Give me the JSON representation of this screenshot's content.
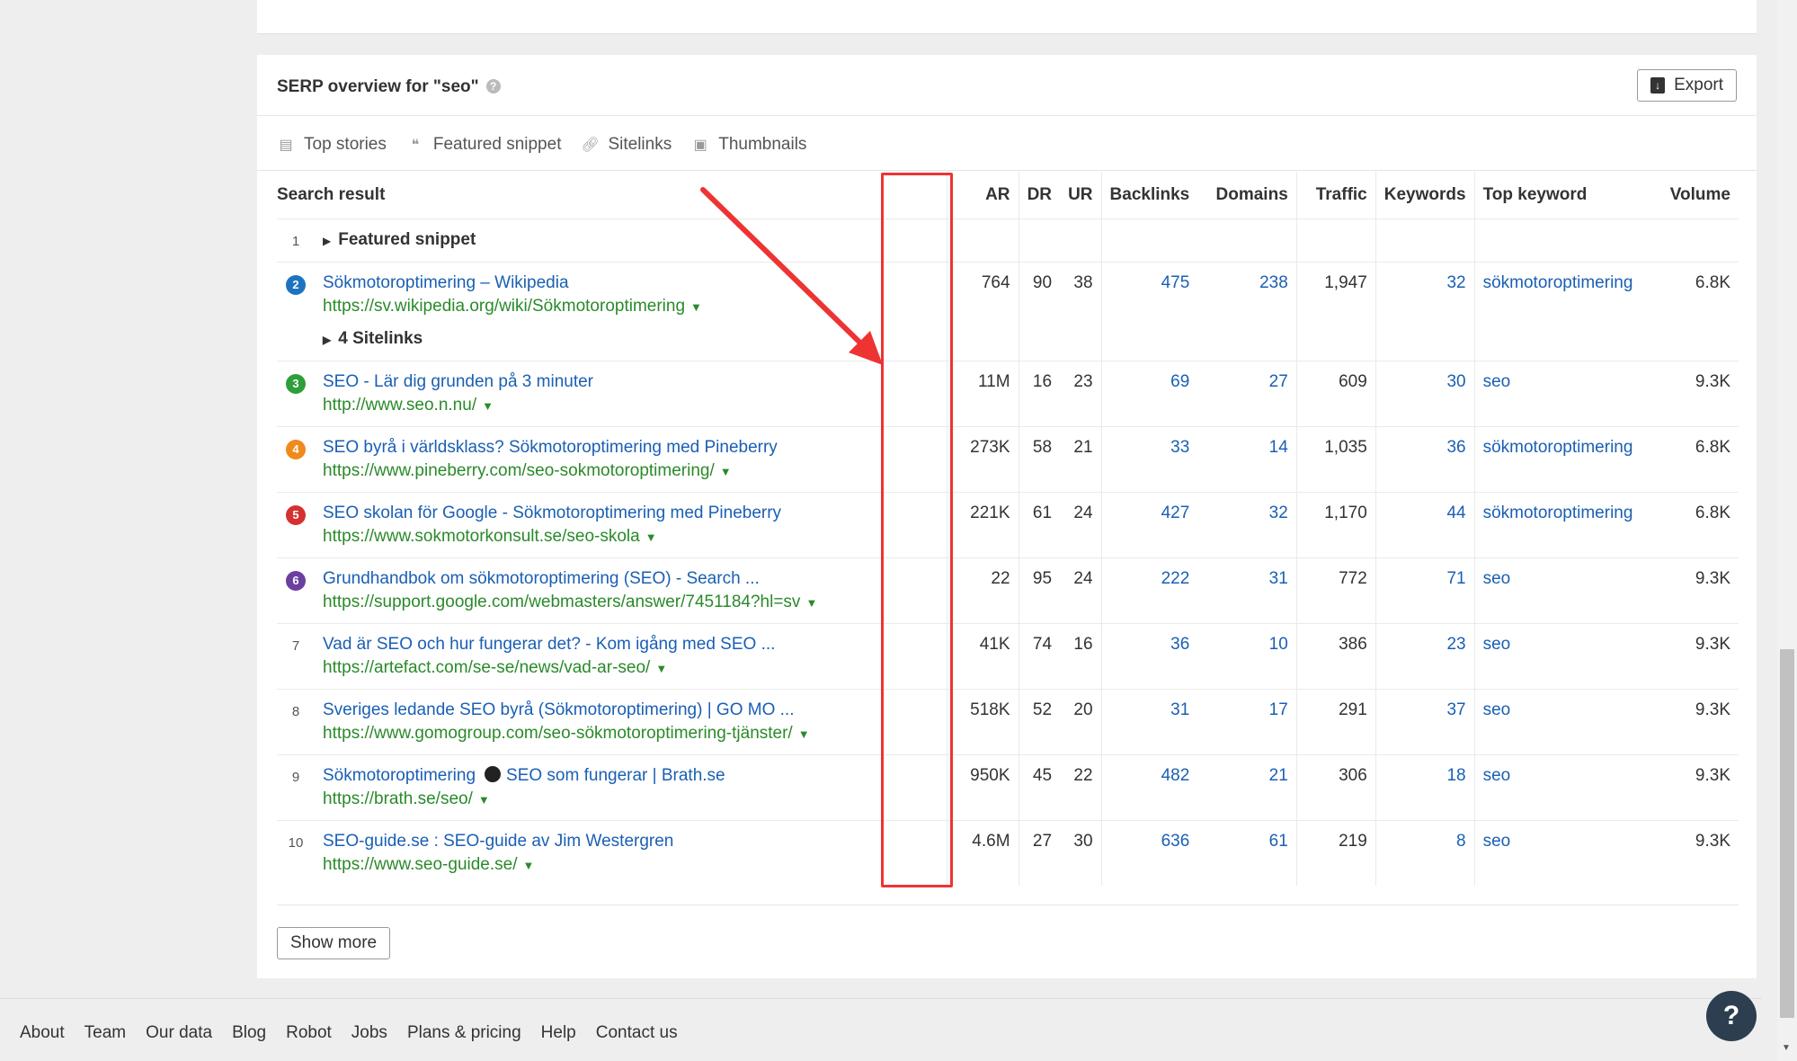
{
  "title": "SERP overview for \"seo\"",
  "export_label": "Export",
  "features": [
    {
      "icon": "top-stories-icon",
      "label": "Top stories"
    },
    {
      "icon": "quote-icon",
      "label": "Featured snippet"
    },
    {
      "icon": "link-icon",
      "label": "Sitelinks"
    },
    {
      "icon": "image-icon",
      "label": "Thumbnails"
    }
  ],
  "columns": {
    "result": "Search result",
    "ar": "AR",
    "dr": "DR",
    "ur": "UR",
    "backlinks": "Backlinks",
    "domains": "Domains",
    "traffic": "Traffic",
    "keywords": "Keywords",
    "top_keyword": "Top keyword",
    "volume": "Volume"
  },
  "featured_snippet": {
    "pos": "1",
    "label": "Featured snippet"
  },
  "rows": [
    {
      "pos": "2",
      "color": "#1e73be",
      "title": "Sökmotoroptimering – Wikipedia",
      "url": "https://sv.wikipedia.org/wiki/Sökmotoroptimering",
      "sitelinks": "4 Sitelinks",
      "ar": "764",
      "dr": "90",
      "ur": "38",
      "backlinks": "475",
      "domains": "238",
      "traffic": "1,947",
      "keywords": "32",
      "top_keyword": "sökmotoroptimering",
      "volume": "6.8K"
    },
    {
      "pos": "3",
      "color": "#2e9e3a",
      "title": "SEO - Lär dig grunden på 3 minuter",
      "url": "http://www.seo.n.nu/",
      "ar": "11M",
      "dr": "16",
      "ur": "23",
      "backlinks": "69",
      "domains": "27",
      "traffic": "609",
      "keywords": "30",
      "top_keyword": "seo",
      "volume": "9.3K"
    },
    {
      "pos": "4",
      "color": "#f08a1c",
      "title": "SEO byrå i världsklass? Sökmotoroptimering med Pineberry",
      "url": "https://www.pineberry.com/seo-sokmotoroptimering/",
      "ar": "273K",
      "dr": "58",
      "ur": "21",
      "backlinks": "33",
      "domains": "14",
      "traffic": "1,035",
      "keywords": "36",
      "top_keyword": "sökmotoroptimering",
      "volume": "6.8K"
    },
    {
      "pos": "5",
      "color": "#d63030",
      "title": "SEO skolan för Google - Sökmotoroptimering med Pineberry",
      "url": "https://www.sokmotorkonsult.se/seo-skola",
      "ar": "221K",
      "dr": "61",
      "ur": "24",
      "backlinks": "427",
      "domains": "32",
      "traffic": "1,170",
      "keywords": "44",
      "top_keyword": "sökmotoroptimering",
      "volume": "6.8K"
    },
    {
      "pos": "6",
      "color": "#6b3fa0",
      "title": "Grundhandbok om sökmotoroptimering (SEO) - Search ...",
      "url": "https://support.google.com/webmasters/answer/7451184?hl=sv",
      "ar": "22",
      "dr": "95",
      "ur": "24",
      "backlinks": "222",
      "domains": "31",
      "traffic": "772",
      "keywords": "71",
      "top_keyword": "seo",
      "volume": "9.3K"
    },
    {
      "pos": "7",
      "color": "",
      "title": "Vad är SEO och hur fungerar det? - Kom igång med SEO ...",
      "url": "https://artefact.com/se-se/news/vad-ar-seo/",
      "ar": "41K",
      "dr": "74",
      "ur": "16",
      "backlinks": "36",
      "domains": "10",
      "traffic": "386",
      "keywords": "23",
      "top_keyword": "seo",
      "volume": "9.3K"
    },
    {
      "pos": "8",
      "color": "",
      "title": "Sveriges ledande SEO byrå (Sökmotoroptimering) | GO MO ...",
      "url": "https://www.gomogroup.com/seo-sökmotoroptimering-tjänster/",
      "ar": "518K",
      "dr": "52",
      "ur": "20",
      "backlinks": "31",
      "domains": "17",
      "traffic": "291",
      "keywords": "37",
      "top_keyword": "seo",
      "volume": "9.3K"
    },
    {
      "pos": "9",
      "color": "",
      "title": "Sökmotoroptimering",
      "title2": "SEO som fungerar | Brath.se",
      "url": "https://brath.se/seo/",
      "ar": "950K",
      "dr": "45",
      "ur": "22",
      "backlinks": "482",
      "domains": "21",
      "traffic": "306",
      "keywords": "18",
      "top_keyword": "seo",
      "volume": "9.3K"
    },
    {
      "pos": "10",
      "color": "",
      "title": "SEO-guide.se : SEO-guide av Jim Westergren",
      "url": "https://www.seo-guide.se/",
      "ar": "4.6M",
      "dr": "27",
      "ur": "30",
      "backlinks": "636",
      "domains": "61",
      "traffic": "219",
      "keywords": "8",
      "top_keyword": "seo",
      "volume": "9.3K"
    }
  ],
  "show_more": "Show more",
  "footer": [
    "About",
    "Team",
    "Our data",
    "Blog",
    "Robot",
    "Jobs",
    "Plans & pricing",
    "Help",
    "Contact us"
  ],
  "help_fab": "?"
}
